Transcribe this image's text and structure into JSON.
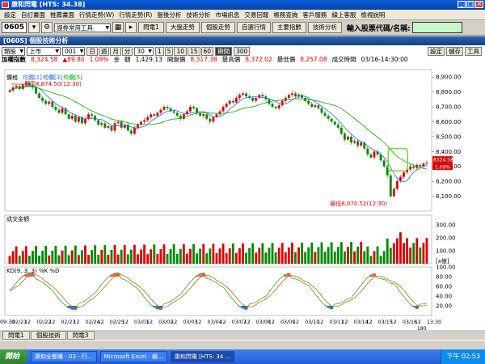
{
  "window": {
    "title": "康和閃電 [HTS: 34.38]"
  },
  "menu": [
    "設定",
    "自訂畫面",
    "推薦畫面",
    "行情走勢(W)",
    "行情走勢(R)",
    "盤後分析",
    "技術分析",
    "市場訊息",
    "交易回報",
    "帳務查詢",
    "客戶服務",
    "線上客服",
    "檢視說明"
  ],
  "toolbar": {
    "code": "0605",
    "dropdown": "證券常用工具",
    "buttons": [
      "閃電1",
      "大盤走勢",
      "個股走勢",
      "自選行情",
      "主要指數",
      "技術分析"
    ],
    "prompt": "輸入股票代碼/名稱:"
  },
  "panel": {
    "title": "[0605] 個股技術分析"
  },
  "controls": {
    "type": "類股",
    "market": "上市",
    "code": "001",
    "periods": [
      "日",
      "週",
      "月",
      "分"
    ],
    "period_min": "30",
    "minute_buttons": [
      "1",
      "5",
      "10",
      "15",
      "60"
    ],
    "active_btn": "期間",
    "count": "300",
    "right_buttons": [
      "設定",
      "儲存",
      "工具"
    ]
  },
  "quote": {
    "name": "加權指數",
    "price": "8,324.58",
    "change": "▲89.80",
    "change_pct": "1.09%",
    "amt_label": "金",
    "volume_label": "額",
    "volume": "1,429.13",
    "open_label": "開盤價",
    "open": "8,317.38",
    "high_label": "最高價",
    "high": "8,372.02",
    "low_label": "最低價",
    "low": "8,257.08",
    "time_label": "成交時間",
    "time": "03/16-14:30:00"
  },
  "chart_panel": {
    "price_legend": "價格",
    "ma_legend": [
      "均價[1]",
      "均價[3]",
      "均價[5]"
    ],
    "high_note": "最高8,874.50(12:30)",
    "low_note": "最低8,070.52(12:30)",
    "last_price_tag": "8324.58",
    "last_pct_tag": "1.09%",
    "volume_title": "成交金額",
    "kd_title": "KD(9, 3, 3) %K %D",
    "ratio_tag": "[x億]",
    "scroll_label": "180",
    "colors": {
      "up": "#dd0000",
      "down": "#008800",
      "ma1": "#3366ff",
      "ma2": "#00aa00",
      "k": "#33aa33",
      "d": "#cc6600"
    }
  },
  "chart_data": [
    {
      "type": "candlestick",
      "title": "",
      "ylim": [
        8000,
        8950
      ],
      "yticks": [
        "8,900.00",
        "8,800.00",
        "8,700.00",
        "8,600.00",
        "8,500.00",
        "8,400.00",
        "8,300.00",
        "8,200.00",
        "8,100.00"
      ],
      "x_labels": [
        "09:30",
        "02/21",
        "12",
        "02/22",
        "12",
        "02/23",
        "12",
        "02/24",
        "12",
        "02/25",
        "12",
        "03/01",
        "12",
        "03/02",
        "12",
        "03/03",
        "12",
        "03/04",
        "12",
        "03/07",
        "12",
        "03/08",
        "12",
        "03/09",
        "12",
        "03/10",
        "12",
        "03/11",
        "12",
        "03/14",
        "12",
        "03/15",
        "12",
        "03/16",
        "12",
        "13:30"
      ],
      "close": [
        8810,
        8830,
        8840,
        8820,
        8850,
        8860,
        8845,
        8830,
        8790,
        8760,
        8740,
        8720,
        8735,
        8700,
        8680,
        8660,
        8690,
        8650,
        8620,
        8640,
        8600,
        8630,
        8590,
        8620,
        8650,
        8640,
        8610,
        8580,
        8590,
        8560,
        8570,
        8540,
        8590,
        8600,
        8560,
        8580,
        8540,
        8520,
        8560,
        8580,
        8600,
        8610,
        8630,
        8650,
        8640,
        8660,
        8680,
        8700,
        8690,
        8670,
        8660,
        8640,
        8620,
        8650,
        8670,
        8700,
        8690,
        8660,
        8640,
        8650,
        8620,
        8600,
        8630,
        8650,
        8670,
        8700,
        8720,
        8740,
        8730,
        8760,
        8780,
        8790,
        8770,
        8760,
        8740,
        8760,
        8780,
        8770,
        8750,
        8720,
        8700,
        8690,
        8710,
        8740,
        8760,
        8780,
        8790,
        8770,
        8780,
        8760,
        8740,
        8720,
        8700,
        8710,
        8690,
        8660,
        8640,
        8620,
        8600,
        8580,
        8560,
        8520,
        8480,
        8500,
        8460,
        8470,
        8440,
        8460,
        8420,
        8380,
        8360,
        8400,
        8380,
        8340,
        8300,
        8240,
        8100,
        8150,
        8200,
        8230,
        8260,
        8280,
        8300,
        8290,
        8310,
        8300,
        8320,
        8325
      ],
      "volume_ylim": [
        0,
        350
      ],
      "volume_yticks": [
        "300.00",
        "200.00",
        "100.00"
      ],
      "kd_ylim": [
        0,
        100
      ],
      "kd_yticks": [
        "100.00",
        "80.00",
        "60.00",
        "40.00",
        "20.00"
      ]
    }
  ],
  "subtabs": [
    "閃電1",
    "個股技術",
    "閃電3"
  ],
  "taskbar": {
    "start": "開始",
    "tasks": [
      "康和全都賺 - 03 - 行...",
      "Microsoft Excel - 績...",
      "康和閃電 [HTS: 34 ..."
    ],
    "clock": "下午 02:53"
  }
}
